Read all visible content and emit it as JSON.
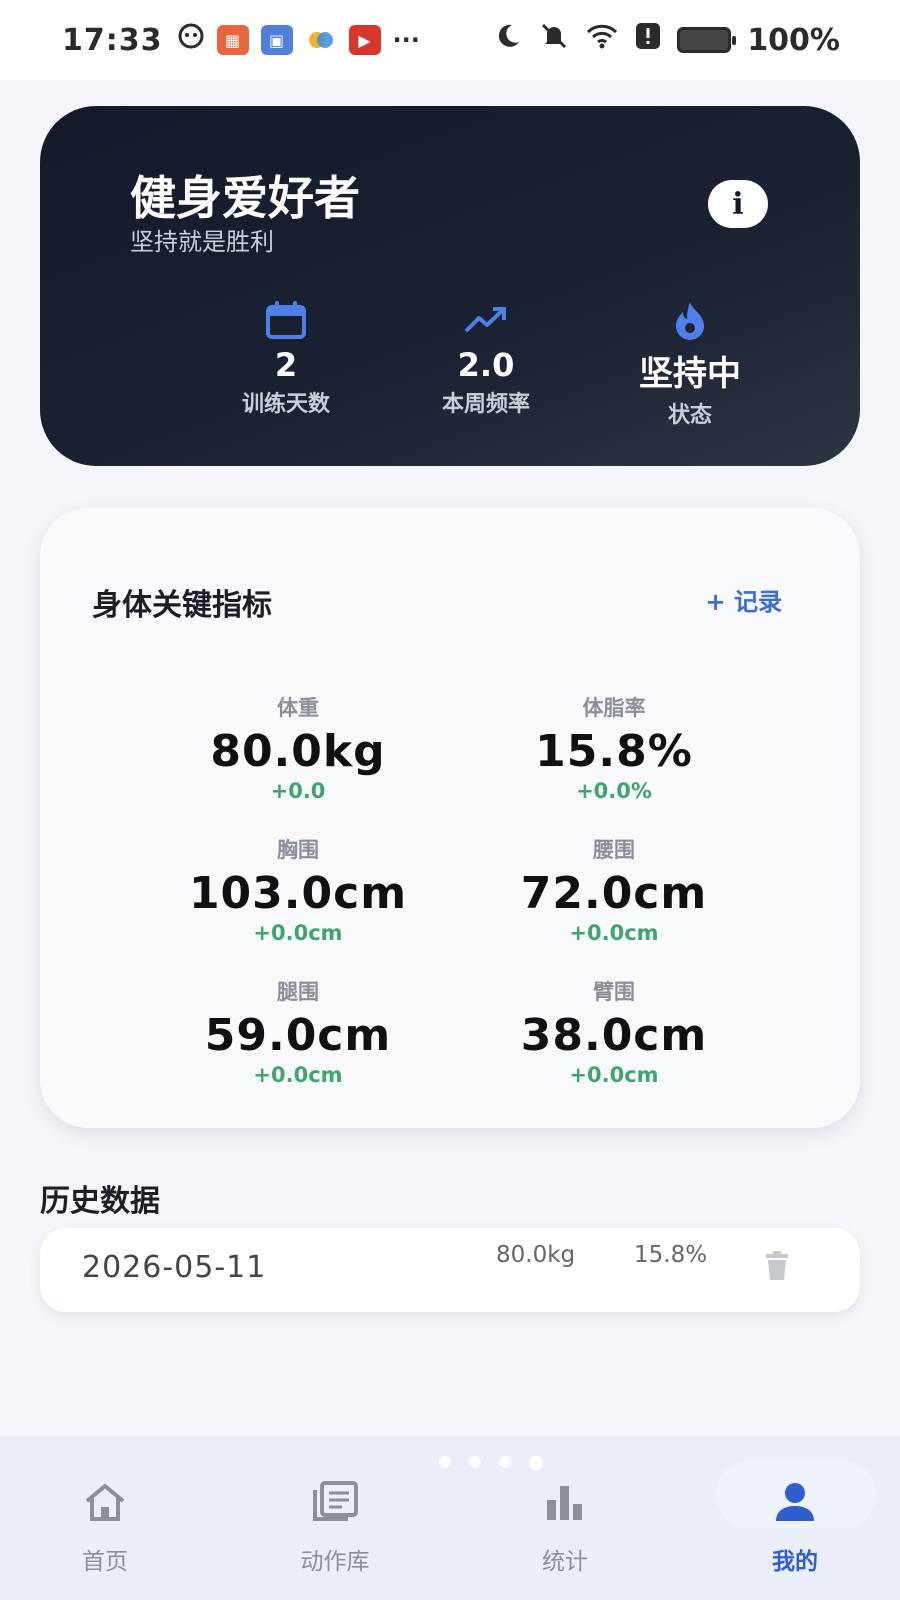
{
  "status_bar": {
    "time": "17:33",
    "more": "···",
    "battery": "100%"
  },
  "hero": {
    "title": "健身爱好者",
    "subtitle": "坚持就是胜利",
    "info_icon": "i",
    "stats": [
      {
        "icon": "calendar-icon",
        "value": "2",
        "label": "训练天数"
      },
      {
        "icon": "trending-up-icon",
        "value": "2.0",
        "label": "本周频率"
      },
      {
        "icon": "flame-icon",
        "value": "坚持中",
        "label": "状态"
      }
    ]
  },
  "metrics": {
    "title": "身体关键指标",
    "record_label": "+ 记录",
    "items": [
      {
        "label": "体重",
        "value": "80.0kg",
        "delta": "+0.0"
      },
      {
        "label": "体脂率",
        "value": "15.8%",
        "delta": "+0.0%"
      },
      {
        "label": "胸围",
        "value": "103.0cm",
        "delta": "+0.0cm"
      },
      {
        "label": "腰围",
        "value": "72.0cm",
        "delta": "+0.0cm"
      },
      {
        "label": "腿围",
        "value": "59.0cm",
        "delta": "+0.0cm"
      },
      {
        "label": "臂围",
        "value": "38.0cm",
        "delta": "+0.0cm"
      }
    ]
  },
  "history": {
    "title": "历史数据",
    "rows": [
      {
        "date": "2026-05-11",
        "weight": "80.0kg",
        "body_fat": "15.8%"
      }
    ]
  },
  "nav": {
    "items": [
      {
        "label": "首页",
        "icon": "home-icon"
      },
      {
        "label": "动作库",
        "icon": "library-icon"
      },
      {
        "label": "统计",
        "icon": "bar-chart-icon"
      },
      {
        "label": "我的",
        "icon": "person-icon"
      }
    ],
    "active_index": 3
  },
  "colors": {
    "accent": "#2f5fcf",
    "positive": "#3fa56a",
    "hero_bg": "#141a29"
  }
}
